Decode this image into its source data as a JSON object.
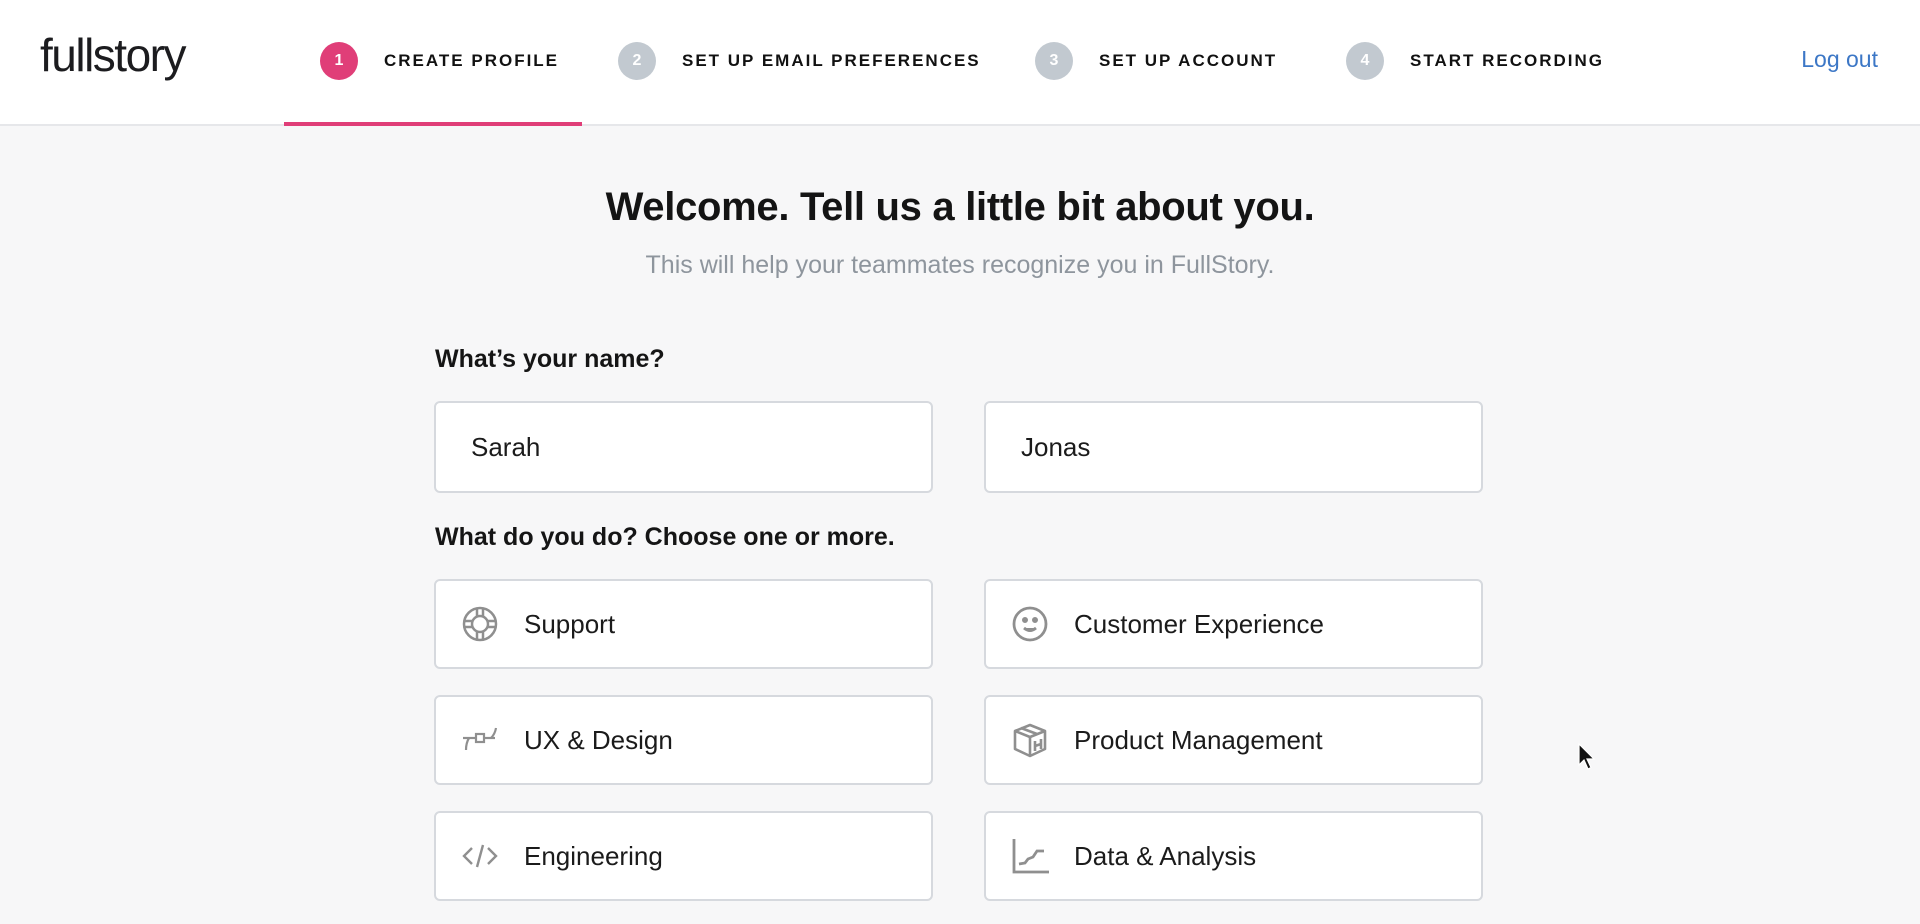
{
  "header": {
    "logo": "fullstory",
    "steps": [
      {
        "number": "1",
        "label": "CREATE PROFILE",
        "state": "active"
      },
      {
        "number": "2",
        "label": "SET UP EMAIL PREFERENCES",
        "state": "inactive"
      },
      {
        "number": "3",
        "label": "SET UP ACCOUNT",
        "state": "inactive"
      },
      {
        "number": "4",
        "label": "START RECORDING",
        "state": "inactive"
      }
    ],
    "logout_label": "Log out"
  },
  "main": {
    "title": "Welcome. Tell us a little bit about you.",
    "subtitle": "This will help your teammates recognize you in FullStory.",
    "name_question": "What’s your name?",
    "first_name_value": "Sarah",
    "last_name_value": "Jonas",
    "role_question": "What do you do? Choose one or more.",
    "roles": [
      {
        "label": "Support",
        "icon": "lifebuoy-icon"
      },
      {
        "label": "Customer Experience",
        "icon": "smiley-icon"
      },
      {
        "label": "UX & Design",
        "icon": "bezier-curve-icon"
      },
      {
        "label": "Product Management",
        "icon": "box-icon"
      },
      {
        "label": "Engineering",
        "icon": "code-icon"
      },
      {
        "label": "Data & Analysis",
        "icon": "line-chart-icon"
      }
    ]
  },
  "colors": {
    "accent": "#e03e78",
    "inactive_step": "#c2c9d0",
    "link": "#3c77c6",
    "icon_gray": "#8f8f8f"
  }
}
